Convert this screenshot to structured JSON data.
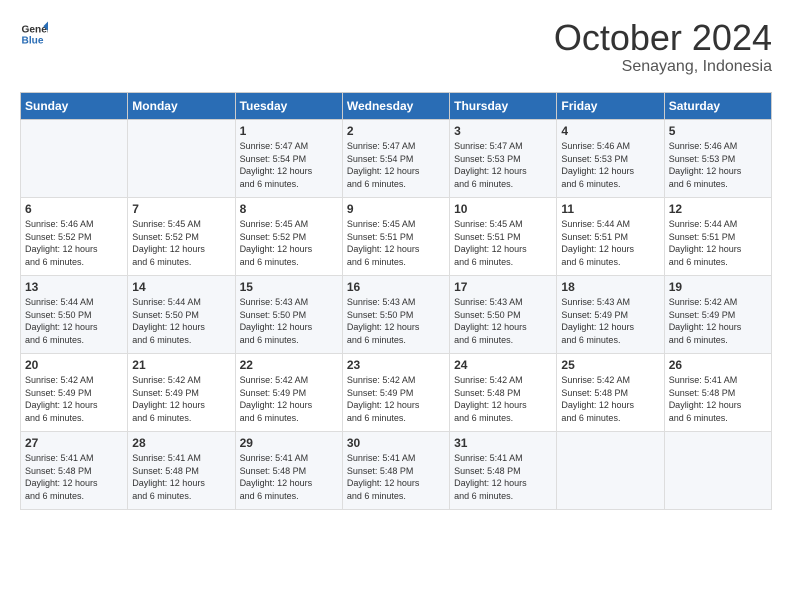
{
  "header": {
    "logo_line1": "General",
    "logo_line2": "Blue",
    "month": "October 2024",
    "location": "Senayang, Indonesia"
  },
  "days_of_week": [
    "Sunday",
    "Monday",
    "Tuesday",
    "Wednesday",
    "Thursday",
    "Friday",
    "Saturday"
  ],
  "weeks": [
    [
      {
        "day": "",
        "content": ""
      },
      {
        "day": "",
        "content": ""
      },
      {
        "day": "1",
        "content": "Sunrise: 5:47 AM\nSunset: 5:54 PM\nDaylight: 12 hours\nand 6 minutes."
      },
      {
        "day": "2",
        "content": "Sunrise: 5:47 AM\nSunset: 5:54 PM\nDaylight: 12 hours\nand 6 minutes."
      },
      {
        "day": "3",
        "content": "Sunrise: 5:47 AM\nSunset: 5:53 PM\nDaylight: 12 hours\nand 6 minutes."
      },
      {
        "day": "4",
        "content": "Sunrise: 5:46 AM\nSunset: 5:53 PM\nDaylight: 12 hours\nand 6 minutes."
      },
      {
        "day": "5",
        "content": "Sunrise: 5:46 AM\nSunset: 5:53 PM\nDaylight: 12 hours\nand 6 minutes."
      }
    ],
    [
      {
        "day": "6",
        "content": "Sunrise: 5:46 AM\nSunset: 5:52 PM\nDaylight: 12 hours\nand 6 minutes."
      },
      {
        "day": "7",
        "content": "Sunrise: 5:45 AM\nSunset: 5:52 PM\nDaylight: 12 hours\nand 6 minutes."
      },
      {
        "day": "8",
        "content": "Sunrise: 5:45 AM\nSunset: 5:52 PM\nDaylight: 12 hours\nand 6 minutes."
      },
      {
        "day": "9",
        "content": "Sunrise: 5:45 AM\nSunset: 5:51 PM\nDaylight: 12 hours\nand 6 minutes."
      },
      {
        "day": "10",
        "content": "Sunrise: 5:45 AM\nSunset: 5:51 PM\nDaylight: 12 hours\nand 6 minutes."
      },
      {
        "day": "11",
        "content": "Sunrise: 5:44 AM\nSunset: 5:51 PM\nDaylight: 12 hours\nand 6 minutes."
      },
      {
        "day": "12",
        "content": "Sunrise: 5:44 AM\nSunset: 5:51 PM\nDaylight: 12 hours\nand 6 minutes."
      }
    ],
    [
      {
        "day": "13",
        "content": "Sunrise: 5:44 AM\nSunset: 5:50 PM\nDaylight: 12 hours\nand 6 minutes."
      },
      {
        "day": "14",
        "content": "Sunrise: 5:44 AM\nSunset: 5:50 PM\nDaylight: 12 hours\nand 6 minutes."
      },
      {
        "day": "15",
        "content": "Sunrise: 5:43 AM\nSunset: 5:50 PM\nDaylight: 12 hours\nand 6 minutes."
      },
      {
        "day": "16",
        "content": "Sunrise: 5:43 AM\nSunset: 5:50 PM\nDaylight: 12 hours\nand 6 minutes."
      },
      {
        "day": "17",
        "content": "Sunrise: 5:43 AM\nSunset: 5:50 PM\nDaylight: 12 hours\nand 6 minutes."
      },
      {
        "day": "18",
        "content": "Sunrise: 5:43 AM\nSunset: 5:49 PM\nDaylight: 12 hours\nand 6 minutes."
      },
      {
        "day": "19",
        "content": "Sunrise: 5:42 AM\nSunset: 5:49 PM\nDaylight: 12 hours\nand 6 minutes."
      }
    ],
    [
      {
        "day": "20",
        "content": "Sunrise: 5:42 AM\nSunset: 5:49 PM\nDaylight: 12 hours\nand 6 minutes."
      },
      {
        "day": "21",
        "content": "Sunrise: 5:42 AM\nSunset: 5:49 PM\nDaylight: 12 hours\nand 6 minutes."
      },
      {
        "day": "22",
        "content": "Sunrise: 5:42 AM\nSunset: 5:49 PM\nDaylight: 12 hours\nand 6 minutes."
      },
      {
        "day": "23",
        "content": "Sunrise: 5:42 AM\nSunset: 5:49 PM\nDaylight: 12 hours\nand 6 minutes."
      },
      {
        "day": "24",
        "content": "Sunrise: 5:42 AM\nSunset: 5:48 PM\nDaylight: 12 hours\nand 6 minutes."
      },
      {
        "day": "25",
        "content": "Sunrise: 5:42 AM\nSunset: 5:48 PM\nDaylight: 12 hours\nand 6 minutes."
      },
      {
        "day": "26",
        "content": "Sunrise: 5:41 AM\nSunset: 5:48 PM\nDaylight: 12 hours\nand 6 minutes."
      }
    ],
    [
      {
        "day": "27",
        "content": "Sunrise: 5:41 AM\nSunset: 5:48 PM\nDaylight: 12 hours\nand 6 minutes."
      },
      {
        "day": "28",
        "content": "Sunrise: 5:41 AM\nSunset: 5:48 PM\nDaylight: 12 hours\nand 6 minutes."
      },
      {
        "day": "29",
        "content": "Sunrise: 5:41 AM\nSunset: 5:48 PM\nDaylight: 12 hours\nand 6 minutes."
      },
      {
        "day": "30",
        "content": "Sunrise: 5:41 AM\nSunset: 5:48 PM\nDaylight: 12 hours\nand 6 minutes."
      },
      {
        "day": "31",
        "content": "Sunrise: 5:41 AM\nSunset: 5:48 PM\nDaylight: 12 hours\nand 6 minutes."
      },
      {
        "day": "",
        "content": ""
      },
      {
        "day": "",
        "content": ""
      }
    ]
  ]
}
